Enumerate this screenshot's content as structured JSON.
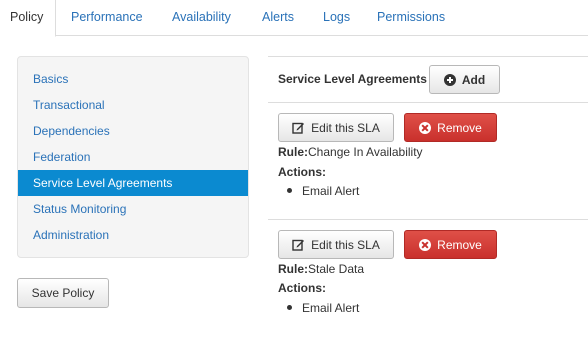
{
  "tabs": [
    {
      "label": "Policy",
      "active": true
    },
    {
      "label": "Performance",
      "active": false
    },
    {
      "label": "Availability",
      "active": false
    },
    {
      "label": "Alerts",
      "active": false
    },
    {
      "label": "Logs",
      "active": false
    },
    {
      "label": "Permissions",
      "active": false
    }
  ],
  "sidebar": {
    "items": [
      {
        "label": "Basics"
      },
      {
        "label": "Transactional"
      },
      {
        "label": "Dependencies"
      },
      {
        "label": "Federation"
      },
      {
        "label": "Service Level Agreements",
        "active": true
      },
      {
        "label": "Status Monitoring"
      },
      {
        "label": "Administration"
      }
    ],
    "save_label": "Save Policy"
  },
  "sla": {
    "title": "Service Level Agreements",
    "add_label": "Add",
    "edit_label": "Edit this SLA",
    "remove_label": "Remove",
    "rule_label": "Rule:",
    "actions_label": "Actions:",
    "entries": [
      {
        "rule": "Change In Availability",
        "actions": [
          "Email Alert"
        ]
      },
      {
        "rule": "Stale Data",
        "actions": [
          "Email Alert"
        ]
      }
    ]
  },
  "colors": {
    "link": "#2a72b8",
    "nav_active": "#0b8ad0",
    "danger": "#c9302c"
  },
  "icons": [
    "plus-circle-icon",
    "edit-icon",
    "remove-circle-icon"
  ]
}
